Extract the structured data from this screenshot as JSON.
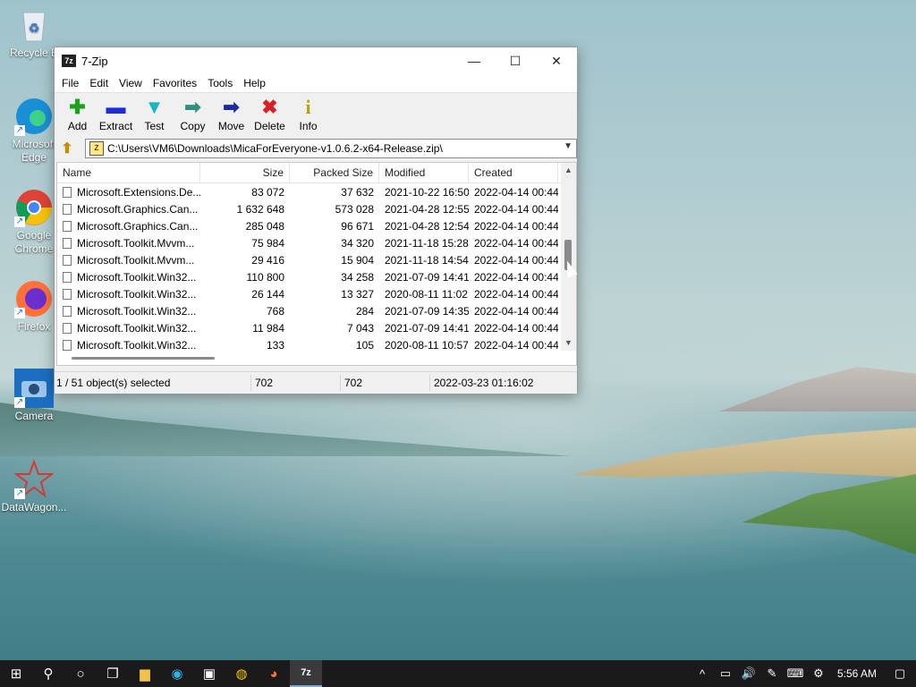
{
  "desktop": {
    "icons": [
      {
        "label": "Recycle Bin",
        "display": "Recycle B",
        "name": "recycle-bin"
      },
      {
        "label": "Microsoft Edge",
        "display": "Microsoft Edge",
        "name": "edge"
      },
      {
        "label": "Google Chrome",
        "display": "Google Chrome",
        "name": "chrome"
      },
      {
        "label": "Firefox",
        "display": "Firefox",
        "name": "firefox"
      },
      {
        "label": "Camera",
        "display": "Camera",
        "name": "camera"
      },
      {
        "label": "DataWagon...",
        "display": "DataWagon...",
        "name": "datawagon"
      }
    ]
  },
  "window": {
    "title": "7-Zip",
    "app_icon_text": "7z",
    "controls": {
      "minimize": "—",
      "maximize": "☐",
      "close": "✕"
    }
  },
  "menu": [
    "File",
    "Edit",
    "View",
    "Favorites",
    "Tools",
    "Help"
  ],
  "toolbar": [
    {
      "label": "Add",
      "glyph": "✚",
      "color": "#1aa31a"
    },
    {
      "label": "Extract",
      "glyph": "▬",
      "color": "#1c2fd6"
    },
    {
      "label": "Test",
      "glyph": "▼",
      "color": "#18b6c4"
    },
    {
      "label": "Copy",
      "glyph": "➡",
      "color": "#2f8f83"
    },
    {
      "label": "Move",
      "glyph": "➡",
      "color": "#1a2aa8"
    },
    {
      "label": "Delete",
      "glyph": "✖",
      "color": "#d92020"
    },
    {
      "label": "Info",
      "glyph": "i",
      "color": "#b8a400"
    }
  ],
  "address": {
    "path": "C:\\Users\\VM6\\Downloads\\MicaForEveryone-v1.0.6.2-x64-Release.zip\\"
  },
  "columns": [
    "Name",
    "Size",
    "Packed Size",
    "Modified",
    "Created"
  ],
  "rows": [
    {
      "name": "Microsoft.Extensions.De...",
      "size": "83 072",
      "packed": "37 632",
      "modified": "2021-10-22 16:50",
      "created": "2022-04-14 00:44"
    },
    {
      "name": "Microsoft.Graphics.Can...",
      "size": "1 632 648",
      "packed": "573 028",
      "modified": "2021-04-28 12:55",
      "created": "2022-04-14 00:44"
    },
    {
      "name": "Microsoft.Graphics.Can...",
      "size": "285 048",
      "packed": "96 671",
      "modified": "2021-04-28 12:54",
      "created": "2022-04-14 00:44"
    },
    {
      "name": "Microsoft.Toolkit.Mvvm...",
      "size": "75 984",
      "packed": "34 320",
      "modified": "2021-11-18 15:28",
      "created": "2022-04-14 00:44"
    },
    {
      "name": "Microsoft.Toolkit.Mvvm...",
      "size": "29 416",
      "packed": "15 904",
      "modified": "2021-11-18 14:54",
      "created": "2022-04-14 00:44"
    },
    {
      "name": "Microsoft.Toolkit.Win32...",
      "size": "110 800",
      "packed": "34 258",
      "modified": "2021-07-09 14:41",
      "created": "2022-04-14 00:44"
    },
    {
      "name": "Microsoft.Toolkit.Win32...",
      "size": "26 144",
      "packed": "13 327",
      "modified": "2020-08-11 11:02",
      "created": "2022-04-14 00:44"
    },
    {
      "name": "Microsoft.Toolkit.Win32...",
      "size": "768",
      "packed": "284",
      "modified": "2021-07-09 14:35",
      "created": "2022-04-14 00:44"
    },
    {
      "name": "Microsoft.Toolkit.Win32...",
      "size": "11 984",
      "packed": "7 043",
      "modified": "2021-07-09 14:41",
      "created": "2022-04-14 00:44"
    },
    {
      "name": "Microsoft.Toolkit.Win32...",
      "size": "133",
      "packed": "105",
      "modified": "2020-08-11 10:57",
      "created": "2022-04-14 00:44"
    }
  ],
  "status": {
    "selection": "1 / 51 object(s) selected",
    "size": "702",
    "packed": "702",
    "date": "2022-03-23 01:16:02"
  },
  "taskbar": {
    "items": [
      {
        "name": "start",
        "glyph": "⊞"
      },
      {
        "name": "search",
        "glyph": "⚲"
      },
      {
        "name": "cortana",
        "glyph": "○"
      },
      {
        "name": "task-view",
        "glyph": "❐"
      },
      {
        "name": "file-explorer",
        "glyph": "▆"
      },
      {
        "name": "edge",
        "glyph": "◉"
      },
      {
        "name": "store",
        "glyph": "▣"
      },
      {
        "name": "chrome",
        "glyph": "◍"
      },
      {
        "name": "firefox",
        "glyph": "◕"
      },
      {
        "name": "7zip",
        "glyph": "7z"
      }
    ],
    "tray": [
      "^",
      "▭",
      "🔊",
      "✎",
      "⌨",
      "⚙"
    ],
    "time": "5:56 AM",
    "notification_glyph": "▢"
  }
}
